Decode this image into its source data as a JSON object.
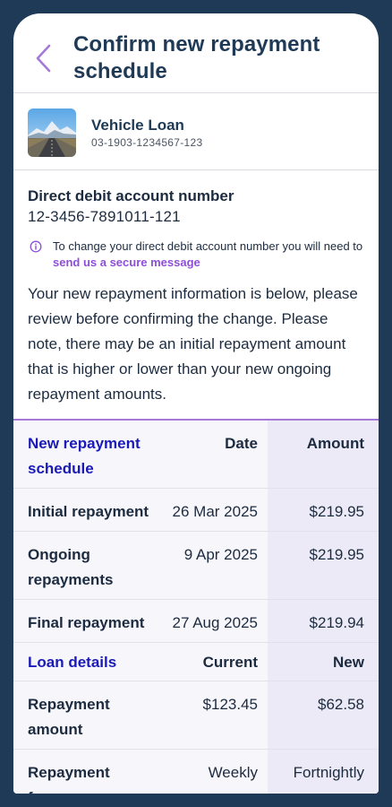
{
  "header": {
    "title": "Confirm new repayment schedule"
  },
  "loan": {
    "name": "Vehicle Loan",
    "number": "03-1903-1234567-123"
  },
  "debit": {
    "label": "Direct debit account number",
    "value": "12-3456-7891011-121",
    "note_text": "To change your direct debit account number you will need to ",
    "note_link": "send us a secure message"
  },
  "intro": "Your new repayment information is below, please review before confirming the change. Please note, there may be an initial repayment amount that is higher or lower than your new ongoing repayment amounts.",
  "schedule": {
    "headers": [
      "New repayment schedule",
      "Date",
      "Amount"
    ],
    "rows": [
      [
        "Initial repayment",
        "26 Mar 2025",
        "$219.95"
      ],
      [
        "Ongoing repayments",
        "9 Apr 2025",
        "$219.95"
      ],
      [
        "Final repayment",
        "27 Aug 2025",
        "$219.94"
      ]
    ]
  },
  "details": {
    "headers": [
      "Loan details",
      "Current",
      "New"
    ],
    "rows": [
      [
        "Repayment amount",
        "$123.45",
        "$62.58"
      ],
      [
        "Repayment frequency",
        "Weekly",
        "Fortnightly"
      ]
    ]
  },
  "colors": {
    "accent_purple": "#8d4fd8",
    "heading_blue": "#1a1ab8",
    "navy": "#1f3a57"
  },
  "icons": {
    "back": "chevron-left-icon",
    "info": "info-circle-icon"
  }
}
